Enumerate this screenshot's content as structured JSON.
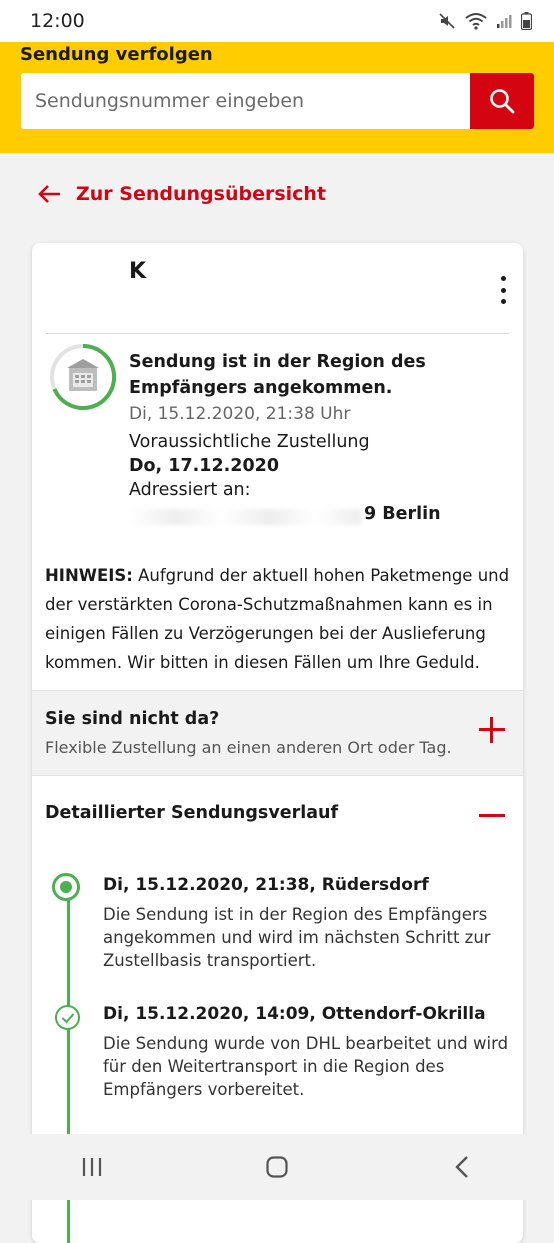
{
  "status_bar": {
    "time": "12:00"
  },
  "header": {
    "title": "Sendung verfolgen"
  },
  "search": {
    "placeholder": "Sendungsnummer eingeben"
  },
  "back_link": {
    "label": "Zur Sendungsübersicht"
  },
  "shipment": {
    "nickname": "K",
    "status_headline": "Sendung ist in der Region des Empfängers angekommen.",
    "status_date": "Di, 15.12.2020, 21:38 Uhr",
    "eta_label": "Voraussichtliche Zustellung",
    "eta_date": "Do, 17.12.2020",
    "address_label": "Adressiert an:",
    "address_visible": "9 Berlin"
  },
  "notice": {
    "label": "HINWEIS:",
    "text": "Aufgrund der aktuell hohen Paketmenge und der verstärkten Corona-Schutzmaßnahmen kann es in einigen Fällen zu Verzögerungen bei der Auslieferung kommen. Wir bitten in diesen Fällen um Ihre Geduld."
  },
  "absent": {
    "title": "Sie sind nicht da?",
    "subtitle": "Flexible Zustellung an einen anderen Ort oder Tag."
  },
  "history": {
    "title": "Detaillierter Sendungsverlauf",
    "events": [
      {
        "title": "Di, 15.12.2020, 21:38, Rüdersdorf",
        "description": "Die Sendung ist in der Region des Empfängers angekommen und wird im nächsten Schritt zur Zustellbasis transportiert."
      },
      {
        "title": "Di, 15.12.2020, 14:09, Ottendorf-Okrilla",
        "description": "Die Sendung wurde von DHL bearbeitet und wird für den Weitertransport in die Region des Empfängers vorbereitet."
      }
    ]
  },
  "colors": {
    "brand_yellow": "#ffcc00",
    "brand_red": "#d40511",
    "progress_green": "#4caf50"
  },
  "icons": [
    "mute-icon",
    "wifi-icon",
    "signal-icon",
    "battery-icon",
    "search-icon",
    "back-arrow-icon",
    "more-options-icon",
    "plus-icon",
    "minus-icon",
    "check-icon",
    "recents-icon",
    "home-icon",
    "back-nav-icon"
  ]
}
